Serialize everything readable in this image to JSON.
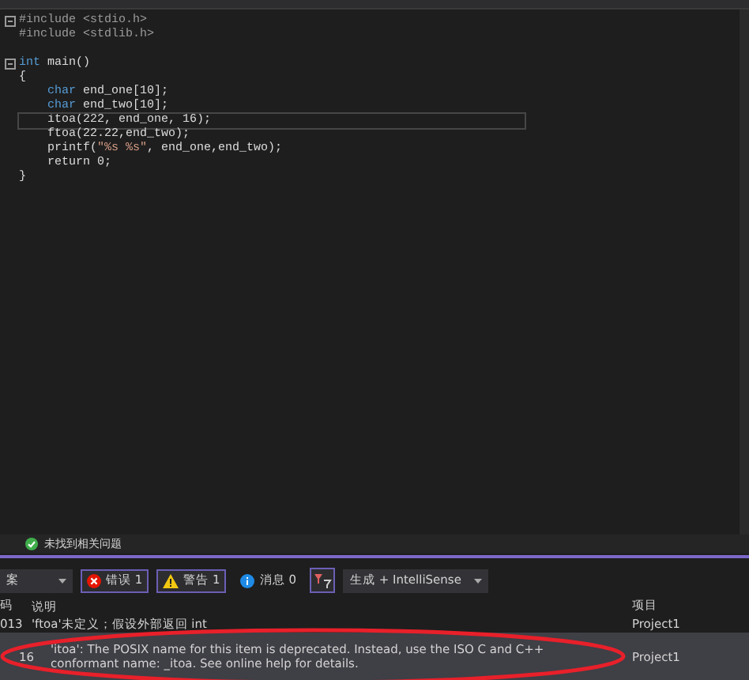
{
  "editor": {
    "blocks": [
      {
        "lines": [
          {
            "foldable": true,
            "current": false,
            "segments": [
              {
                "kind": "pre",
                "text": "#include <stdio.h>"
              }
            ]
          },
          {
            "foldable": false,
            "current": false,
            "segments": [
              {
                "kind": "pre",
                "text": "#include <stdlib.h>"
              }
            ]
          }
        ]
      },
      {
        "lines": [
          {
            "foldable": true,
            "current": false,
            "segments": [
              {
                "kind": "kw",
                "text": "int"
              },
              {
                "kind": "id",
                "text": " main()"
              }
            ]
          },
          {
            "foldable": false,
            "current": false,
            "segments": [
              {
                "kind": "id",
                "text": "{"
              }
            ]
          },
          {
            "foldable": false,
            "current": false,
            "segments": [
              {
                "kind": "kw",
                "text": "    char"
              },
              {
                "kind": "id",
                "text": " end_one[10];"
              }
            ]
          },
          {
            "foldable": false,
            "current": false,
            "segments": [
              {
                "kind": "kw",
                "text": "    char"
              },
              {
                "kind": "id",
                "text": " end_two[10];"
              }
            ]
          },
          {
            "foldable": false,
            "current": true,
            "segments": [
              {
                "kind": "id",
                "text": "    itoa(222, end_one, 16);"
              }
            ]
          },
          {
            "foldable": false,
            "current": false,
            "segments": [
              {
                "kind": "id",
                "text": "    ftoa(22.22,end_two);"
              }
            ]
          },
          {
            "foldable": false,
            "current": false,
            "segments": [
              {
                "kind": "id",
                "text": "    printf("
              },
              {
                "kind": "str",
                "text": "\"%s %s\""
              },
              {
                "kind": "id",
                "text": ", end_one,end_two);"
              }
            ]
          },
          {
            "foldable": false,
            "current": false,
            "segments": [
              {
                "kind": "id",
                "text": "    return 0;"
              }
            ]
          },
          {
            "foldable": false,
            "current": false,
            "segments": [
              {
                "kind": "id",
                "text": "}"
              }
            ]
          }
        ]
      }
    ]
  },
  "status": {
    "text": "未找到相关问题"
  },
  "error_list": {
    "toolbar": {
      "scope": "案",
      "errors": {
        "label": "错误 1",
        "selected": true
      },
      "warnings": {
        "label": "警告 1",
        "selected": true
      },
      "messages": {
        "label": "消息 0",
        "selected": false
      },
      "source": "生成 + IntelliSense"
    },
    "columns": [
      "码",
      "说明",
      "项目"
    ],
    "rows": [
      {
        "code": "013",
        "description": "'ftoa'未定义；假设外部返回 int",
        "project": "Project1",
        "selected": false,
        "circled": false
      },
      {
        "code": "16",
        "description": "'itoa': The POSIX name for this item is deprecated. Instead, use the ISO C and C++ conformant name: _itoa. See online help for details.",
        "project": "Project1",
        "selected": true,
        "circled": true
      }
    ]
  }
}
